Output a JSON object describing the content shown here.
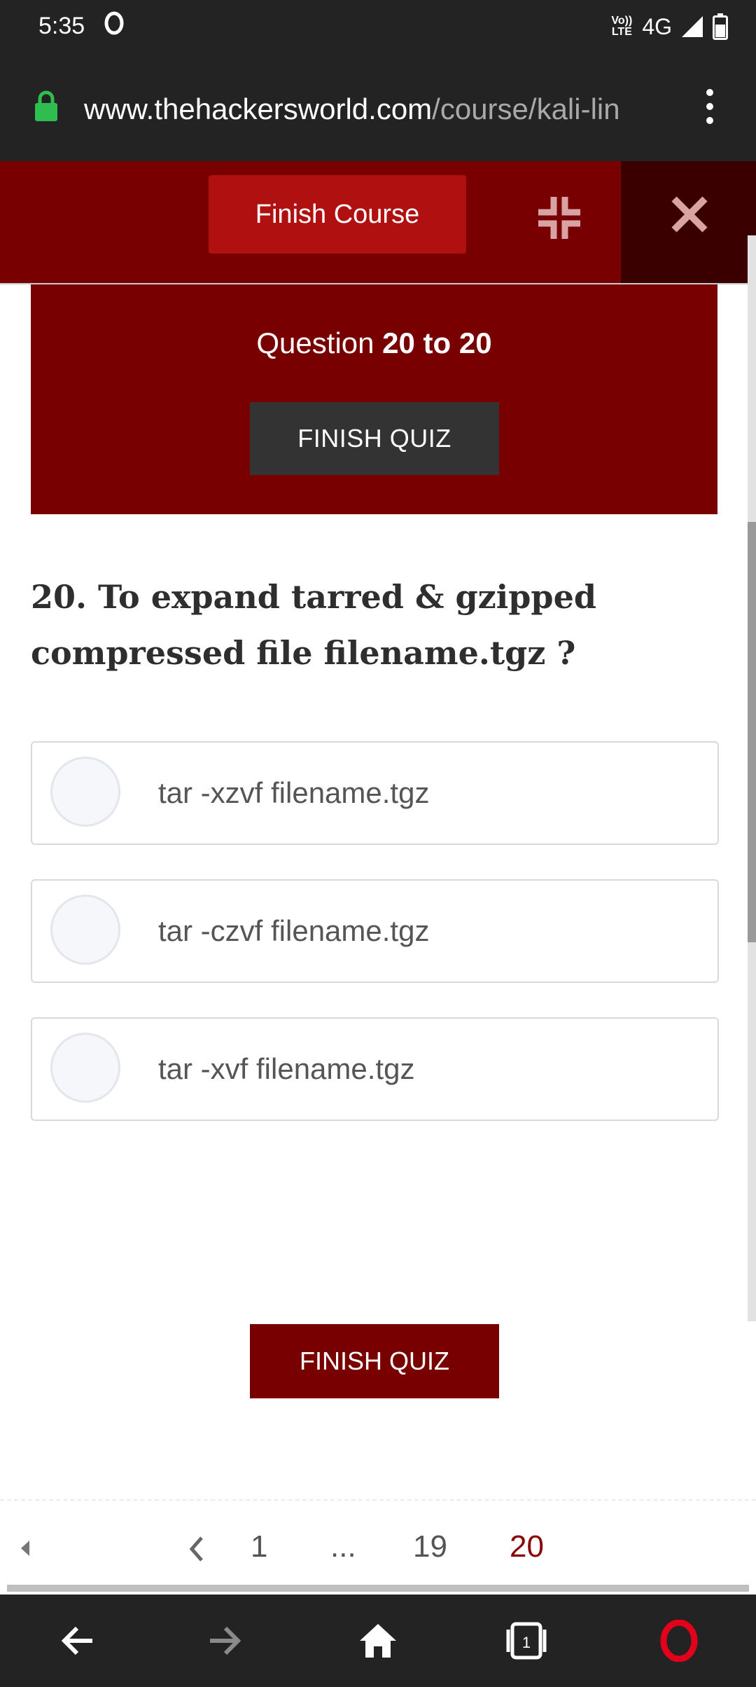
{
  "status_bar": {
    "time": "5:35",
    "volte_line1": "Vo))",
    "volte_line2": "LTE",
    "network": "4G"
  },
  "browser": {
    "url_domain": "www.thehackersworld.com",
    "url_path": "/course/kali-lin"
  },
  "course_header": {
    "finish_course_label": "Finish Course"
  },
  "quiz_header": {
    "question_prefix": "Question ",
    "question_range": "20 to 20",
    "finish_quiz_label": "FINISH QUIZ"
  },
  "question": {
    "text": "20. To expand tarred & gzipped compressed file filename.tgz ?"
  },
  "options": [
    {
      "label": "tar -xzvf filename.tgz"
    },
    {
      "label": "tar -czvf filename.tgz"
    },
    {
      "label": "tar -xvf filename.tgz"
    }
  ],
  "bottom": {
    "finish_quiz_label": "FINISH QUIZ"
  },
  "pagination": {
    "pages": [
      "1",
      "...",
      "19",
      "20"
    ],
    "current_page": "20"
  },
  "colors": {
    "accent": "#780000",
    "finish_course_button": "#b01010",
    "dark_bar": "#232323"
  }
}
